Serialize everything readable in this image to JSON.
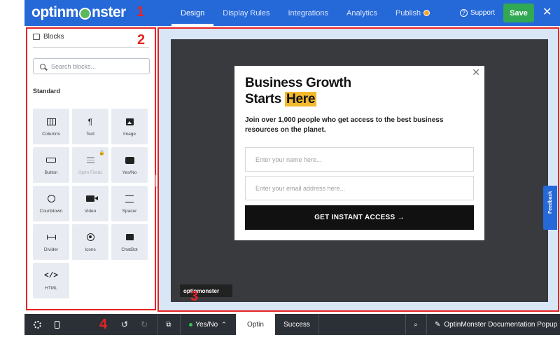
{
  "header": {
    "logo": "optinmonster",
    "marker": "1",
    "tabs": [
      {
        "label": "Design",
        "active": true
      },
      {
        "label": "Display Rules",
        "active": false
      },
      {
        "label": "Integrations",
        "active": false
      },
      {
        "label": "Analytics",
        "active": false
      },
      {
        "label": "Publish",
        "active": false
      }
    ],
    "support": "Support",
    "save": "Save",
    "close": "✕"
  },
  "sidebar": {
    "marker": "2",
    "title": "Blocks",
    "search_placeholder": "Search blocks...",
    "section": "Standard",
    "blocks": [
      {
        "label": "Columns",
        "icon": "columns-icon"
      },
      {
        "label": "Text",
        "icon": "text-icon"
      },
      {
        "label": "Image",
        "icon": "image-icon"
      },
      {
        "label": "Button",
        "icon": "button-icon"
      },
      {
        "label": "Optin Fields",
        "icon": "optin-fields-icon",
        "locked": true
      },
      {
        "label": "Yes/No",
        "icon": "yes-no-icon"
      },
      {
        "label": "Countdown",
        "icon": "clock-icon"
      },
      {
        "label": "Video",
        "icon": "video-icon"
      },
      {
        "label": "Spacer",
        "icon": "spacer-icon"
      },
      {
        "label": "Divider",
        "icon": "divider-icon"
      },
      {
        "label": "Icons",
        "icon": "icons-icon"
      },
      {
        "label": "ChatBot",
        "icon": "chat-icon"
      },
      {
        "label": "HTML",
        "icon": "code-icon"
      }
    ]
  },
  "canvas": {
    "marker": "3",
    "popup": {
      "title_line1": "Business Growth",
      "title_line2_prefix": "Starts ",
      "title_highlight": "Here",
      "subtitle": "Join over 1,000 people who get access to the best business resources on the planet.",
      "name_placeholder": "Enter your name here...",
      "email_placeholder": "Enter your email address here...",
      "cta": "GET INSTANT ACCESS →",
      "close": "✕"
    },
    "badge": "optinmonster",
    "feedback": "Feedback"
  },
  "footer": {
    "marker": "4",
    "yes_no": "Yes/No",
    "tabs": [
      {
        "label": "Optin",
        "active": true
      },
      {
        "label": "Success",
        "active": false
      }
    ],
    "campaign_name": "OptinMonster Documentation Popup"
  },
  "colors": {
    "brand_blue": "#2568d8",
    "save_green": "#31a854",
    "marker_red": "#e52424",
    "highlight_yellow": "#f3b92c"
  }
}
